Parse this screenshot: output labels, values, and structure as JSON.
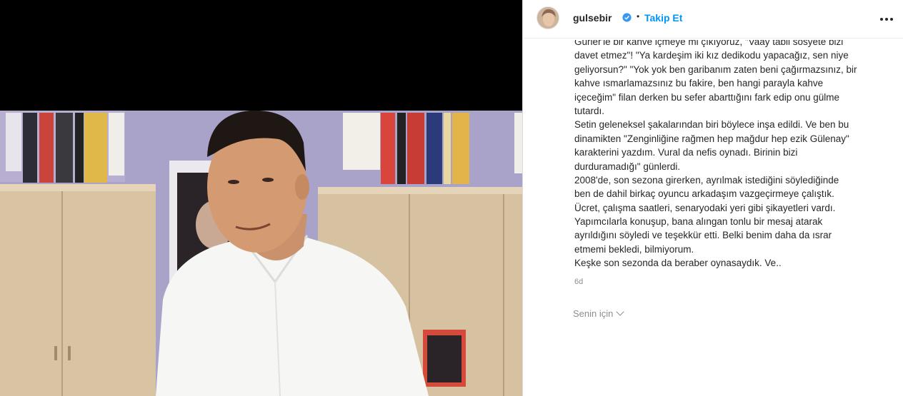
{
  "post": {
    "username": "gulsebir",
    "follow_label": "Takip Et",
    "separator": "•",
    "caption_lines": [
      "Gürler'le bir kahve içmeye mi çıkıyoruz, \"Vaay tabii sosyete bizi",
      "davet etmez\"! \"Ya kardeşim  iki kız dedikodu yapacağız, sen niye",
      "geliyorsun?\" \"Yok yok ben garibanım zaten beni çağırmazsınız, bir",
      "kahve ısmarlamazsınız bu fakire, ben hangi parayla kahve",
      "içeceğim\" filan derken bu sefer abarttığını fark edip onu gülme",
      "tutardı.",
      "Setin geleneksel şakalarından biri böylece inşa edildi. Ve ben bu",
      "dinamikten \"Zenginliğine rağmen hep mağdur hep ezik Gülenay\"",
      "karakterini yazdım. Vural da nefis oynadı. Birinin bizi",
      "durduramadığı\" günlerdi.",
      "2008'de, son sezona girerken, ayrılmak istediğini söylediğinde",
      "ben de dahil birkaç oyuncu arkadaşım vazgeçirmeye çalıştık.",
      "Ücret, çalışma saatleri, senaryodaki yeri gibi şikayetleri vardı.",
      "Yapımcılarla konuşup, bana alıngan tonlu bir mesaj atarak",
      "ayrıldığını söyledi ve teşekkür etti. Belki benim daha da ısrar",
      "etmemi bekledi, bilmiyorum.",
      "Keşke son sezonda da beraber oynasaydık. Ve.."
    ],
    "time_ago": "6d",
    "for_you_label": "Senin için"
  },
  "colors": {
    "accent": "#0095f6",
    "text": "#262626",
    "muted": "#8e8e8e"
  },
  "icons": {
    "verified": "verified-badge-icon",
    "more": "more-options-icon",
    "dropdown": "chevron-down-icon"
  }
}
